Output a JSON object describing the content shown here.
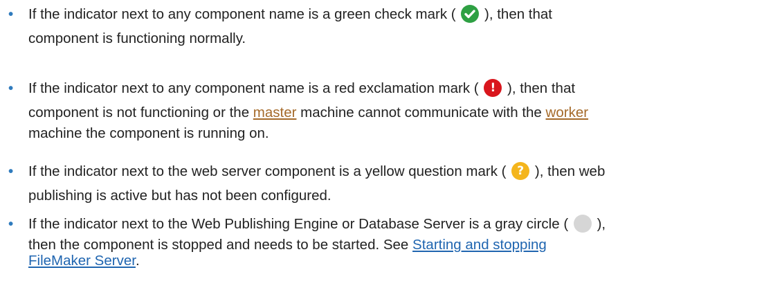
{
  "items": [
    {
      "pre": "If the indicator next to any component name is a green check mark (",
      "icon": "green-check-icon",
      "line1_post": "), then that",
      "line2": "component is functioning normally."
    },
    {
      "pre": "If the indicator next to any component name is a red exclamation mark (",
      "icon": "red-exclamation-icon",
      "line1_post": "), then that",
      "line2_pre": "component is not functioning or the ",
      "link1": "master",
      "line2_mid": " machine cannot communicate with the ",
      "link2": "worker",
      "line3": "machine the component is running on."
    },
    {
      "pre": "If the indicator next to the web server component is a yellow question mark (",
      "icon": "yellow-question-icon",
      "line1_post": "), then web",
      "line2": "publishing is active but has not been configured."
    },
    {
      "pre": "If the indicator next to the Web Publishing Engine or Database Server is a gray circle (",
      "icon": "gray-circle-icon",
      "line1_post": "),",
      "line2_pre": "then the component is stopped and needs to be started. See ",
      "link1": "Starting and stopping",
      "link2": "FileMaker Server",
      "line3_post": "."
    }
  ],
  "colors": {
    "bullet": "#2f7bbd",
    "link_glossary": "#a56a2a",
    "link_topic": "#1f65b0"
  }
}
